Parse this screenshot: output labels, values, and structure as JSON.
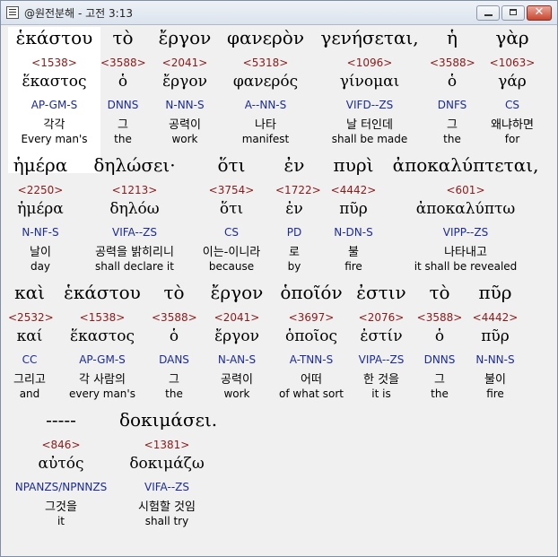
{
  "window": {
    "title": "@원전분해 - 고전 3:13"
  },
  "lines": [
    {
      "words": [
        {
          "greek": "ἑκάστου",
          "num": "<1538>",
          "lemma": "ἕκαστος",
          "code": "AP-GM-S",
          "korean": "각각",
          "english": "Every man's"
        },
        {
          "greek": "τὸ",
          "num": "<3588>",
          "lemma": "ὁ",
          "code": "DNNS",
          "korean": "그",
          "english": "the"
        },
        {
          "greek": "ἔργον",
          "num": "<2041>",
          "lemma": "ἔργον",
          "code": "N-NN-S",
          "korean": "공력이",
          "english": "work"
        },
        {
          "greek": "φανερὸν",
          "num": "<5318>",
          "lemma": "φανερός",
          "code": "A--NN-S",
          "korean": "나타",
          "english": "manifest"
        },
        {
          "greek": "γενήσεται,",
          "num": "<1096>",
          "lemma": "γίνομαι",
          "code": "VIFD--ZS",
          "korean": "날 터인데",
          "english": "shall be made"
        },
        {
          "greek": "ἡ",
          "num": "<3588>",
          "lemma": "ὁ",
          "code": "DNFS",
          "korean": "그",
          "english": "the"
        },
        {
          "greek": "γὰρ",
          "num": "<1063>",
          "lemma": "γάρ",
          "code": "CS",
          "korean": "왜냐하면",
          "english": "for"
        }
      ]
    },
    {
      "words": [
        {
          "greek": "ἡμέρα",
          "num": "<2250>",
          "lemma": "ἡμέρα",
          "code": "N-NF-S",
          "korean": "날이",
          "english": "day"
        },
        {
          "greek": "δηλώσει·",
          "num": "<1213>",
          "lemma": "δηλόω",
          "code": "VIFA--ZS",
          "korean": "공력을 밝히리니",
          "english": "shall declare it"
        },
        {
          "greek": "ὅτι",
          "num": "<3754>",
          "lemma": "ὅτι",
          "code": "CS",
          "korean": "이는-이니라",
          "english": "because"
        },
        {
          "greek": "ἐν",
          "num": "<1722>",
          "lemma": "ἐν",
          "code": "PD",
          "korean": "로",
          "english": "by"
        },
        {
          "greek": "πυρὶ",
          "num": "<4442>",
          "lemma": "πῦρ",
          "code": "N-DN-S",
          "korean": "불",
          "english": "fire"
        },
        {
          "greek": "ἀποκαλύπτεται,",
          "num": "<601>",
          "lemma": "ἀποκαλύπτω",
          "code": "VIPP--ZS",
          "korean": "나타내고",
          "english": "it shall be revealed"
        }
      ]
    },
    {
      "words": [
        {
          "greek": "καὶ",
          "num": "<2532>",
          "lemma": "καί",
          "code": "CC",
          "korean": "그리고",
          "english": "and"
        },
        {
          "greek": "ἑκάστου",
          "num": "<1538>",
          "lemma": "ἕκαστος",
          "code": "AP-GM-S",
          "korean": "각 사람의",
          "english": "every man's"
        },
        {
          "greek": "τὸ",
          "num": "<3588>",
          "lemma": "ὁ",
          "code": "DANS",
          "korean": "그",
          "english": "the"
        },
        {
          "greek": "ἔργον",
          "num": "<2041>",
          "lemma": "ἔργον",
          "code": "N-AN-S",
          "korean": "공력이",
          "english": "work"
        },
        {
          "greek": "ὁποῖόν",
          "num": "<3697>",
          "lemma": "ὁποῖος",
          "code": "A-TNN-S",
          "korean": "어떠",
          "english": "of what sort"
        },
        {
          "greek": "ἐστιν",
          "num": "<2076>",
          "lemma": "ἐστίν",
          "code": "VIPA--ZS",
          "korean": "한 것을",
          "english": "it is"
        },
        {
          "greek": "τὸ",
          "num": "<3588>",
          "lemma": "ὁ",
          "code": "DNNS",
          "korean": "그",
          "english": "the"
        },
        {
          "greek": "πῦρ",
          "num": "<4442>",
          "lemma": "πῦρ",
          "code": "N-NN-S",
          "korean": "불이",
          "english": "fire"
        }
      ]
    },
    {
      "words": [
        {
          "greek": "-----",
          "num": "<846>",
          "lemma": "αὐτός",
          "code": "NPANZS/NPNNZS",
          "korean": "그것을",
          "english": "it"
        },
        {
          "greek": "δοκιμάσει.",
          "num": "<1381>",
          "lemma": "δοκιμάζω",
          "code": "VIFA--ZS",
          "korean": "시험할 것임",
          "english": "shall try"
        }
      ]
    }
  ]
}
